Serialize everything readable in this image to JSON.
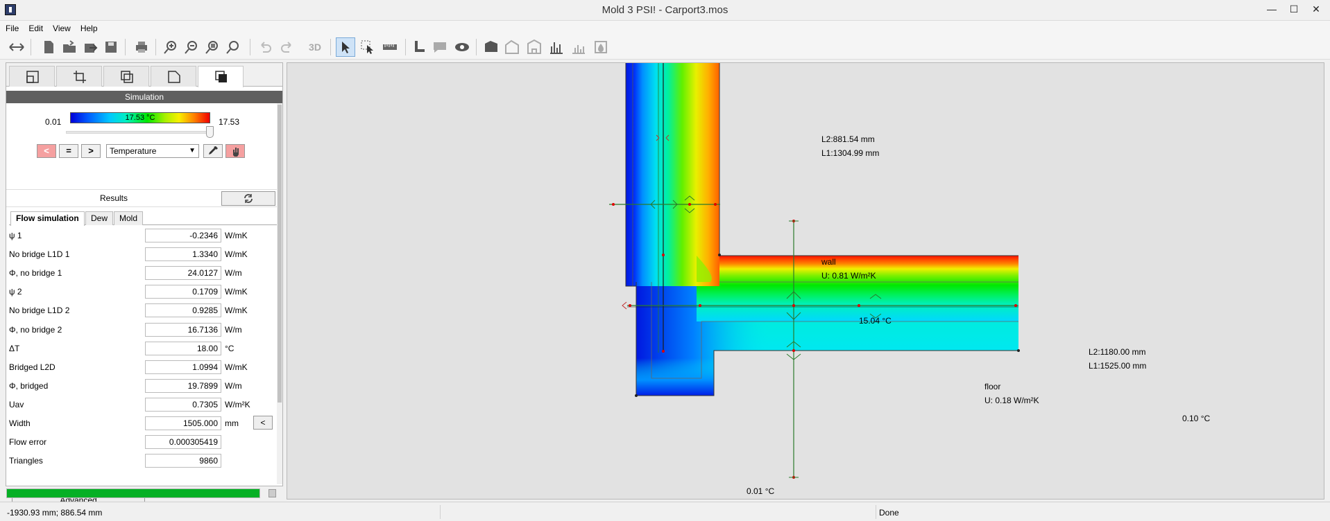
{
  "window": {
    "title": "Mold 3 PSI! - Carport3.mos",
    "minimize": "—",
    "maximize": "☐",
    "close": "✕"
  },
  "menu": [
    "File",
    "Edit",
    "View",
    "Help"
  ],
  "toolbar": {
    "icons": [
      "arrows-icon",
      "new-file-icon",
      "open-file-icon",
      "export-icon",
      "save-icon",
      "print-icon",
      "zoom-in-icon",
      "zoom-out-icon",
      "zoom-fit-icon",
      "zoom-reset-icon",
      "undo-icon",
      "redo-icon",
      "3d-icon",
      "select-arrow-icon",
      "select-node-icon",
      "measure-icon",
      "corner-icon",
      "comment-icon",
      "eye-icon",
      "fill-icon",
      "building-icon",
      "building-alt-icon",
      "bar-chart-icon",
      "bar-chart-g-icon",
      "moisture-icon"
    ],
    "label_3d": "3D"
  },
  "panel": {
    "section_title": "Simulation",
    "scale": {
      "min": "0.01",
      "max": "17.53",
      "current": "17.53 °C",
      "slider_fraction": 1.0
    },
    "buttons": {
      "prev": "<",
      "equal": "=",
      "next": ">"
    },
    "mode_select": "Temperature",
    "results_label": "Results",
    "tabs": [
      "Flow simulation",
      "Dew",
      "Mold"
    ],
    "rows": [
      {
        "label": "ψ 1",
        "value": "-0.2346",
        "unit": "W/mK"
      },
      {
        "label": "No bridge L1D 1",
        "value": "1.3340",
        "unit": "W/mK"
      },
      {
        "label": "Φ, no bridge 1",
        "value": "24.0127",
        "unit": "W/m"
      },
      {
        "label": "ψ 2",
        "value": "0.1709",
        "unit": "W/mK"
      },
      {
        "label": "No bridge L1D 2",
        "value": "0.9285",
        "unit": "W/mK"
      },
      {
        "label": "Φ, no bridge 2",
        "value": "16.7136",
        "unit": "W/m"
      },
      {
        "label": "ΔT",
        "value": "18.00",
        "unit": "°C"
      },
      {
        "label": "Bridged L2D",
        "value": "1.0994",
        "unit": "W/mK"
      },
      {
        "label": "Φ, bridged",
        "value": "19.7899",
        "unit": "W/m"
      },
      {
        "label": "Uav",
        "value": "0.7305",
        "unit": "W/m²K"
      },
      {
        "label": "Width",
        "value": "1505.000",
        "unit": "mm",
        "button": "<"
      },
      {
        "label": "Flow error",
        "value": "0.000305419",
        "unit": ""
      },
      {
        "label": "Triangles",
        "value": "9860",
        "unit": ""
      }
    ],
    "advanced_label": "Advanced",
    "progress_fraction": 1.0
  },
  "canvas": {
    "wall_l2": "L2:881.54 mm",
    "wall_l1": "L1:1304.99 mm",
    "wall_name": "wall",
    "wall_u": "U: 0.81 W/m²K",
    "corner_temp": "15.04 °C",
    "floor_l2": "L2:1180.00 mm",
    "floor_l1": "L1:1525.00 mm",
    "floor_name": "floor",
    "floor_u": "U: 0.18 W/m²K",
    "temp_right": "0.10 °C",
    "temp_bottom": "0.01 °C"
  },
  "status": {
    "coords": "-1930.93 mm; 886.54 mm",
    "state": "Done"
  }
}
